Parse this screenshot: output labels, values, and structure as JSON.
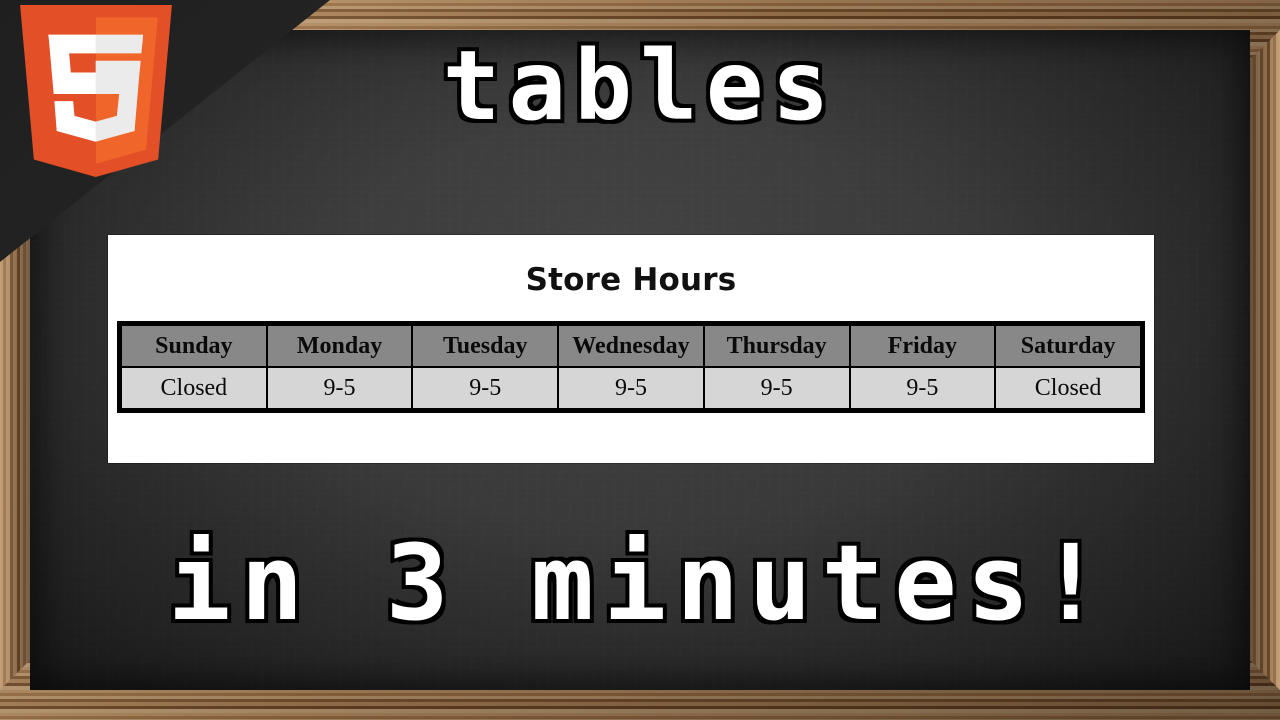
{
  "video": {
    "title": "tables",
    "subtitle": "in 3 minutes!",
    "logo_name": "html5-shield-logo"
  },
  "colors": {
    "html5_orange": "#e34f26",
    "html5_orange_light": "#f06529",
    "chalkboard": "#3a3a3a",
    "wood_frame": "#9d7045",
    "table_header_bg": "#888888",
    "table_cell_bg": "#d6d6d6",
    "panel_bg": "#ffffff"
  },
  "panel": {
    "caption": "Store Hours"
  },
  "table": {
    "headers": [
      "Sunday",
      "Monday",
      "Tuesday",
      "Wednesday",
      "Thursday",
      "Friday",
      "Saturday"
    ],
    "rows": [
      [
        "Closed",
        "9-5",
        "9-5",
        "9-5",
        "9-5",
        "9-5",
        "Closed"
      ]
    ]
  }
}
